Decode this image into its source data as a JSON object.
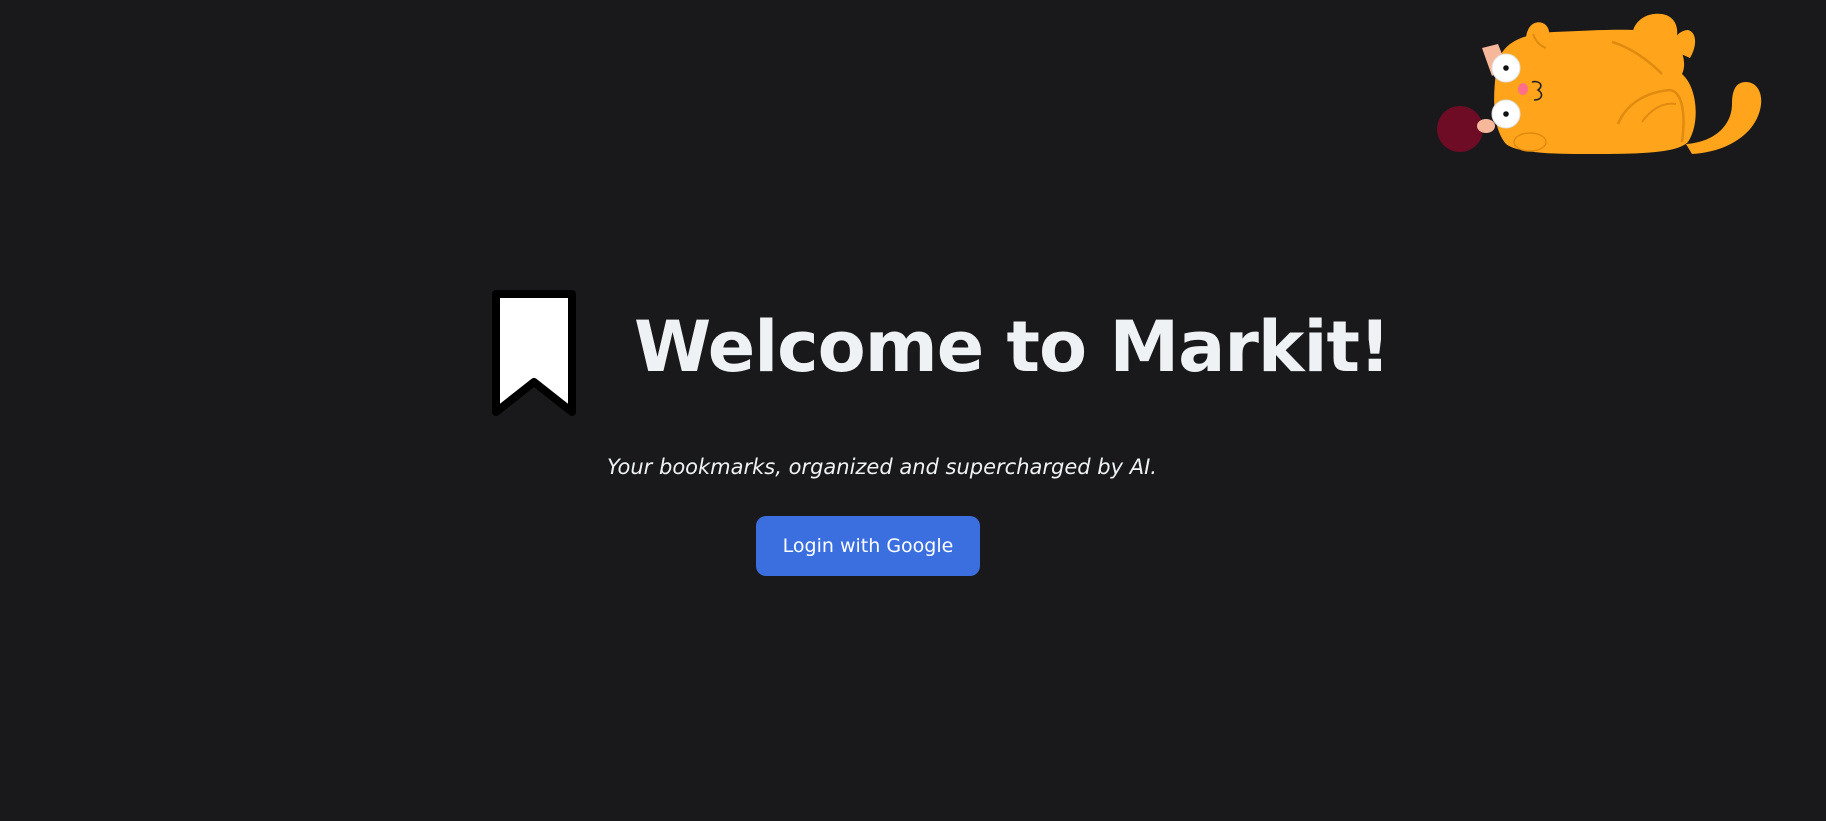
{
  "hero": {
    "title": "Welcome to Markit!",
    "tagline": "Your bookmarks, organized and supercharged by AI."
  },
  "actions": {
    "login_label": "Login with Google"
  },
  "icons": {
    "bookmark": "bookmark-icon",
    "mascot": "cat-illustration"
  },
  "colors": {
    "background": "#19191b",
    "title_text": "#eef2f4",
    "button": "#3b6fe0",
    "cat_body": "#ffa41b",
    "yarn_ball": "#6e0b25"
  }
}
